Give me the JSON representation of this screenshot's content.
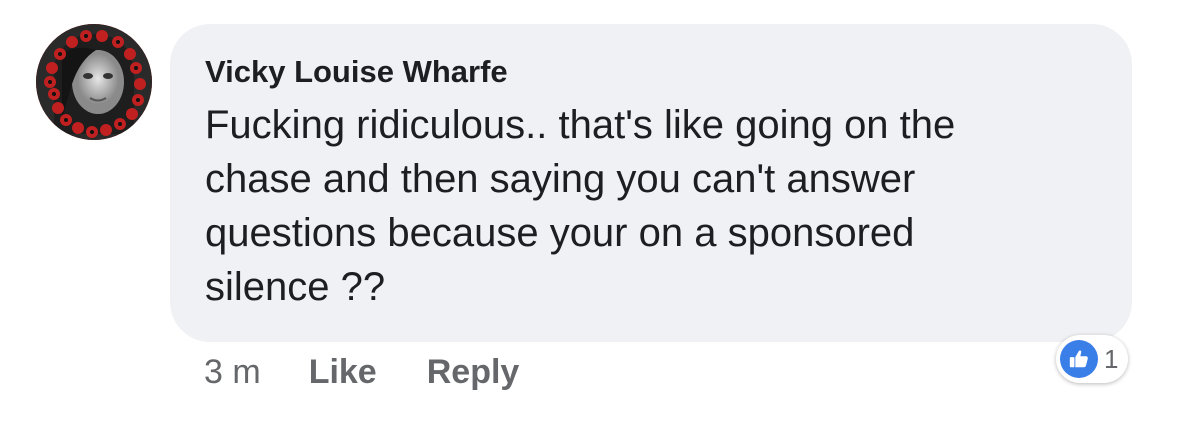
{
  "comment": {
    "author": "Vicky Louise Wharfe",
    "text": "Fucking ridiculous.. that's like going on the\nchase and then saying you can't answer\nquestions because your on a sponsored\nsilence ??",
    "timestamp": "3 m",
    "like_label": "Like",
    "reply_label": "Reply",
    "reaction": {
      "icon": "thumbs-up-icon",
      "count": "1",
      "color": "#3a7ee8"
    }
  },
  "colors": {
    "bubble": "#f0f1f4",
    "text": "#1c1e21",
    "muted": "#65676b",
    "avatar_border": "#b81d1d"
  }
}
